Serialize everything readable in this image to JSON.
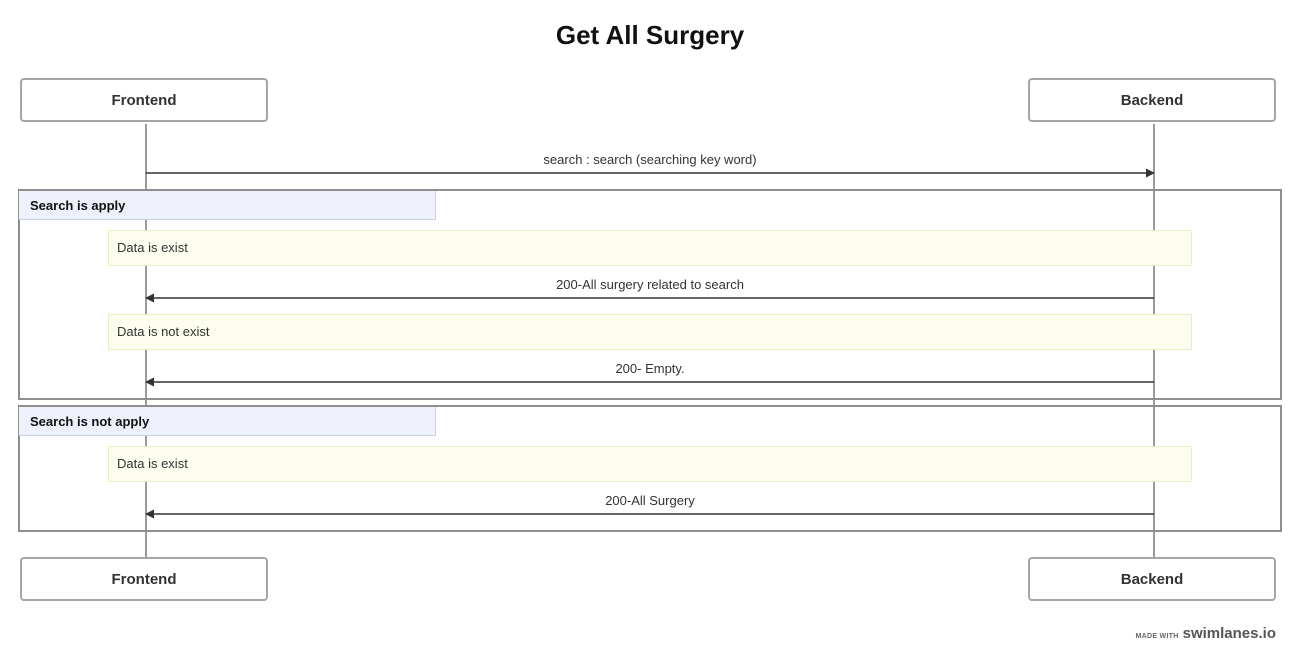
{
  "title": "Get All Surgery",
  "participants": {
    "frontend": "Frontend",
    "backend": "Backend"
  },
  "messages": [
    {
      "label": "search : search (searching key word)",
      "direction": "right"
    },
    {
      "label": "200-All surgery related to search",
      "direction": "left"
    },
    {
      "label": "200- Empty.",
      "direction": "left"
    },
    {
      "label": "200-All Surgery",
      "direction": "left"
    }
  ],
  "groups": [
    {
      "label": "Search is apply"
    },
    {
      "label": "Search is not apply"
    }
  ],
  "notes": [
    {
      "label": "Data is exist"
    },
    {
      "label": "Data is not exist"
    },
    {
      "label": "Data is exist"
    }
  ],
  "branding": {
    "made_with": "MADE WITH",
    "name": "swimlanes.io"
  },
  "colors": {
    "lifeline": "#9a9a9a",
    "arrow": "#333333",
    "note_bg": "#fefef0",
    "group_label_bg": "#eef1fb"
  }
}
